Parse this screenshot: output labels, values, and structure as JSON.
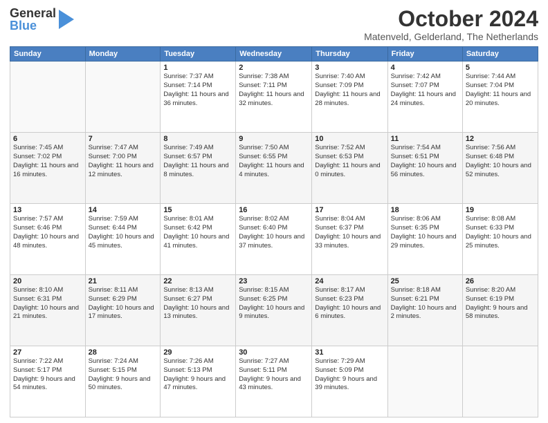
{
  "header": {
    "logo_line1": "General",
    "logo_line2": "Blue",
    "month": "October 2024",
    "location": "Matenveld, Gelderland, The Netherlands"
  },
  "days_of_week": [
    "Sunday",
    "Monday",
    "Tuesday",
    "Wednesday",
    "Thursday",
    "Friday",
    "Saturday"
  ],
  "weeks": [
    [
      {
        "day": "",
        "info": ""
      },
      {
        "day": "",
        "info": ""
      },
      {
        "day": "1",
        "info": "Sunrise: 7:37 AM\nSunset: 7:14 PM\nDaylight: 11 hours\nand 36 minutes."
      },
      {
        "day": "2",
        "info": "Sunrise: 7:38 AM\nSunset: 7:11 PM\nDaylight: 11 hours\nand 32 minutes."
      },
      {
        "day": "3",
        "info": "Sunrise: 7:40 AM\nSunset: 7:09 PM\nDaylight: 11 hours\nand 28 minutes."
      },
      {
        "day": "4",
        "info": "Sunrise: 7:42 AM\nSunset: 7:07 PM\nDaylight: 11 hours\nand 24 minutes."
      },
      {
        "day": "5",
        "info": "Sunrise: 7:44 AM\nSunset: 7:04 PM\nDaylight: 11 hours\nand 20 minutes."
      }
    ],
    [
      {
        "day": "6",
        "info": "Sunrise: 7:45 AM\nSunset: 7:02 PM\nDaylight: 11 hours\nand 16 minutes."
      },
      {
        "day": "7",
        "info": "Sunrise: 7:47 AM\nSunset: 7:00 PM\nDaylight: 11 hours\nand 12 minutes."
      },
      {
        "day": "8",
        "info": "Sunrise: 7:49 AM\nSunset: 6:57 PM\nDaylight: 11 hours\nand 8 minutes."
      },
      {
        "day": "9",
        "info": "Sunrise: 7:50 AM\nSunset: 6:55 PM\nDaylight: 11 hours\nand 4 minutes."
      },
      {
        "day": "10",
        "info": "Sunrise: 7:52 AM\nSunset: 6:53 PM\nDaylight: 11 hours\nand 0 minutes."
      },
      {
        "day": "11",
        "info": "Sunrise: 7:54 AM\nSunset: 6:51 PM\nDaylight: 10 hours\nand 56 minutes."
      },
      {
        "day": "12",
        "info": "Sunrise: 7:56 AM\nSunset: 6:48 PM\nDaylight: 10 hours\nand 52 minutes."
      }
    ],
    [
      {
        "day": "13",
        "info": "Sunrise: 7:57 AM\nSunset: 6:46 PM\nDaylight: 10 hours\nand 48 minutes."
      },
      {
        "day": "14",
        "info": "Sunrise: 7:59 AM\nSunset: 6:44 PM\nDaylight: 10 hours\nand 45 minutes."
      },
      {
        "day": "15",
        "info": "Sunrise: 8:01 AM\nSunset: 6:42 PM\nDaylight: 10 hours\nand 41 minutes."
      },
      {
        "day": "16",
        "info": "Sunrise: 8:02 AM\nSunset: 6:40 PM\nDaylight: 10 hours\nand 37 minutes."
      },
      {
        "day": "17",
        "info": "Sunrise: 8:04 AM\nSunset: 6:37 PM\nDaylight: 10 hours\nand 33 minutes."
      },
      {
        "day": "18",
        "info": "Sunrise: 8:06 AM\nSunset: 6:35 PM\nDaylight: 10 hours\nand 29 minutes."
      },
      {
        "day": "19",
        "info": "Sunrise: 8:08 AM\nSunset: 6:33 PM\nDaylight: 10 hours\nand 25 minutes."
      }
    ],
    [
      {
        "day": "20",
        "info": "Sunrise: 8:10 AM\nSunset: 6:31 PM\nDaylight: 10 hours\nand 21 minutes."
      },
      {
        "day": "21",
        "info": "Sunrise: 8:11 AM\nSunset: 6:29 PM\nDaylight: 10 hours\nand 17 minutes."
      },
      {
        "day": "22",
        "info": "Sunrise: 8:13 AM\nSunset: 6:27 PM\nDaylight: 10 hours\nand 13 minutes."
      },
      {
        "day": "23",
        "info": "Sunrise: 8:15 AM\nSunset: 6:25 PM\nDaylight: 10 hours\nand 9 minutes."
      },
      {
        "day": "24",
        "info": "Sunrise: 8:17 AM\nSunset: 6:23 PM\nDaylight: 10 hours\nand 6 minutes."
      },
      {
        "day": "25",
        "info": "Sunrise: 8:18 AM\nSunset: 6:21 PM\nDaylight: 10 hours\nand 2 minutes."
      },
      {
        "day": "26",
        "info": "Sunrise: 8:20 AM\nSunset: 6:19 PM\nDaylight: 9 hours\nand 58 minutes."
      }
    ],
    [
      {
        "day": "27",
        "info": "Sunrise: 7:22 AM\nSunset: 5:17 PM\nDaylight: 9 hours\nand 54 minutes."
      },
      {
        "day": "28",
        "info": "Sunrise: 7:24 AM\nSunset: 5:15 PM\nDaylight: 9 hours\nand 50 minutes."
      },
      {
        "day": "29",
        "info": "Sunrise: 7:26 AM\nSunset: 5:13 PM\nDaylight: 9 hours\nand 47 minutes."
      },
      {
        "day": "30",
        "info": "Sunrise: 7:27 AM\nSunset: 5:11 PM\nDaylight: 9 hours\nand 43 minutes."
      },
      {
        "day": "31",
        "info": "Sunrise: 7:29 AM\nSunset: 5:09 PM\nDaylight: 9 hours\nand 39 minutes."
      },
      {
        "day": "",
        "info": ""
      },
      {
        "day": "",
        "info": ""
      }
    ]
  ]
}
